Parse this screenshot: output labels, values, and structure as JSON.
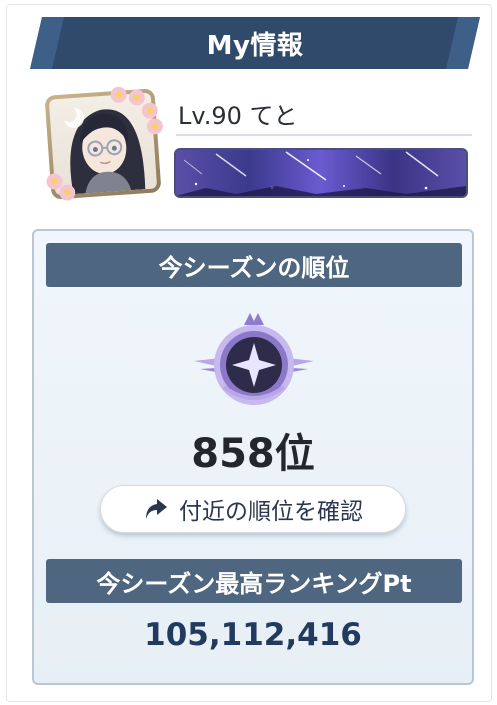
{
  "header": {
    "title": "My情報"
  },
  "profile": {
    "name_line": "Lv.90 てと",
    "avatar_icon": "player-avatar-icon",
    "title_plate_icon": "shooting-stars-plate"
  },
  "season_rank": {
    "heading": "今シーズンの順位",
    "rank": "858位",
    "emblem_icon": "rank-emblem-icon",
    "nearby_button_label": "付近の順位を確認",
    "button_icon": "share-arrow-icon"
  },
  "season_best": {
    "heading": "今シーズン最高ランキングPt",
    "points": "105,112,416"
  },
  "colors": {
    "banner": "#2f4a6b",
    "section_bar": "#4f6680",
    "points_text": "#223a5e"
  }
}
